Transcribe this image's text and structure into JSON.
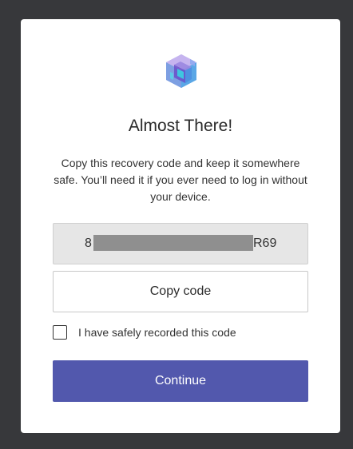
{
  "dialog": {
    "title": "Almost There!",
    "description": "Copy this recovery code and keep it somewhere safe. You’ll need it if you ever need to log in without your device.",
    "code_visible_start": "8",
    "code_visible_end": "R69",
    "code_redacted": true,
    "copy_label": "Copy code",
    "checkbox_label": "I have safely recorded this code",
    "checkbox_checked": false,
    "continue_label": "Continue"
  },
  "icons": {
    "logo": "cube-logo-icon"
  },
  "colors": {
    "background": "#37383b",
    "card": "#ffffff",
    "primary_button": "#5258ad",
    "code_box": "#e6e6e6",
    "redaction": "#8f8f8f"
  }
}
